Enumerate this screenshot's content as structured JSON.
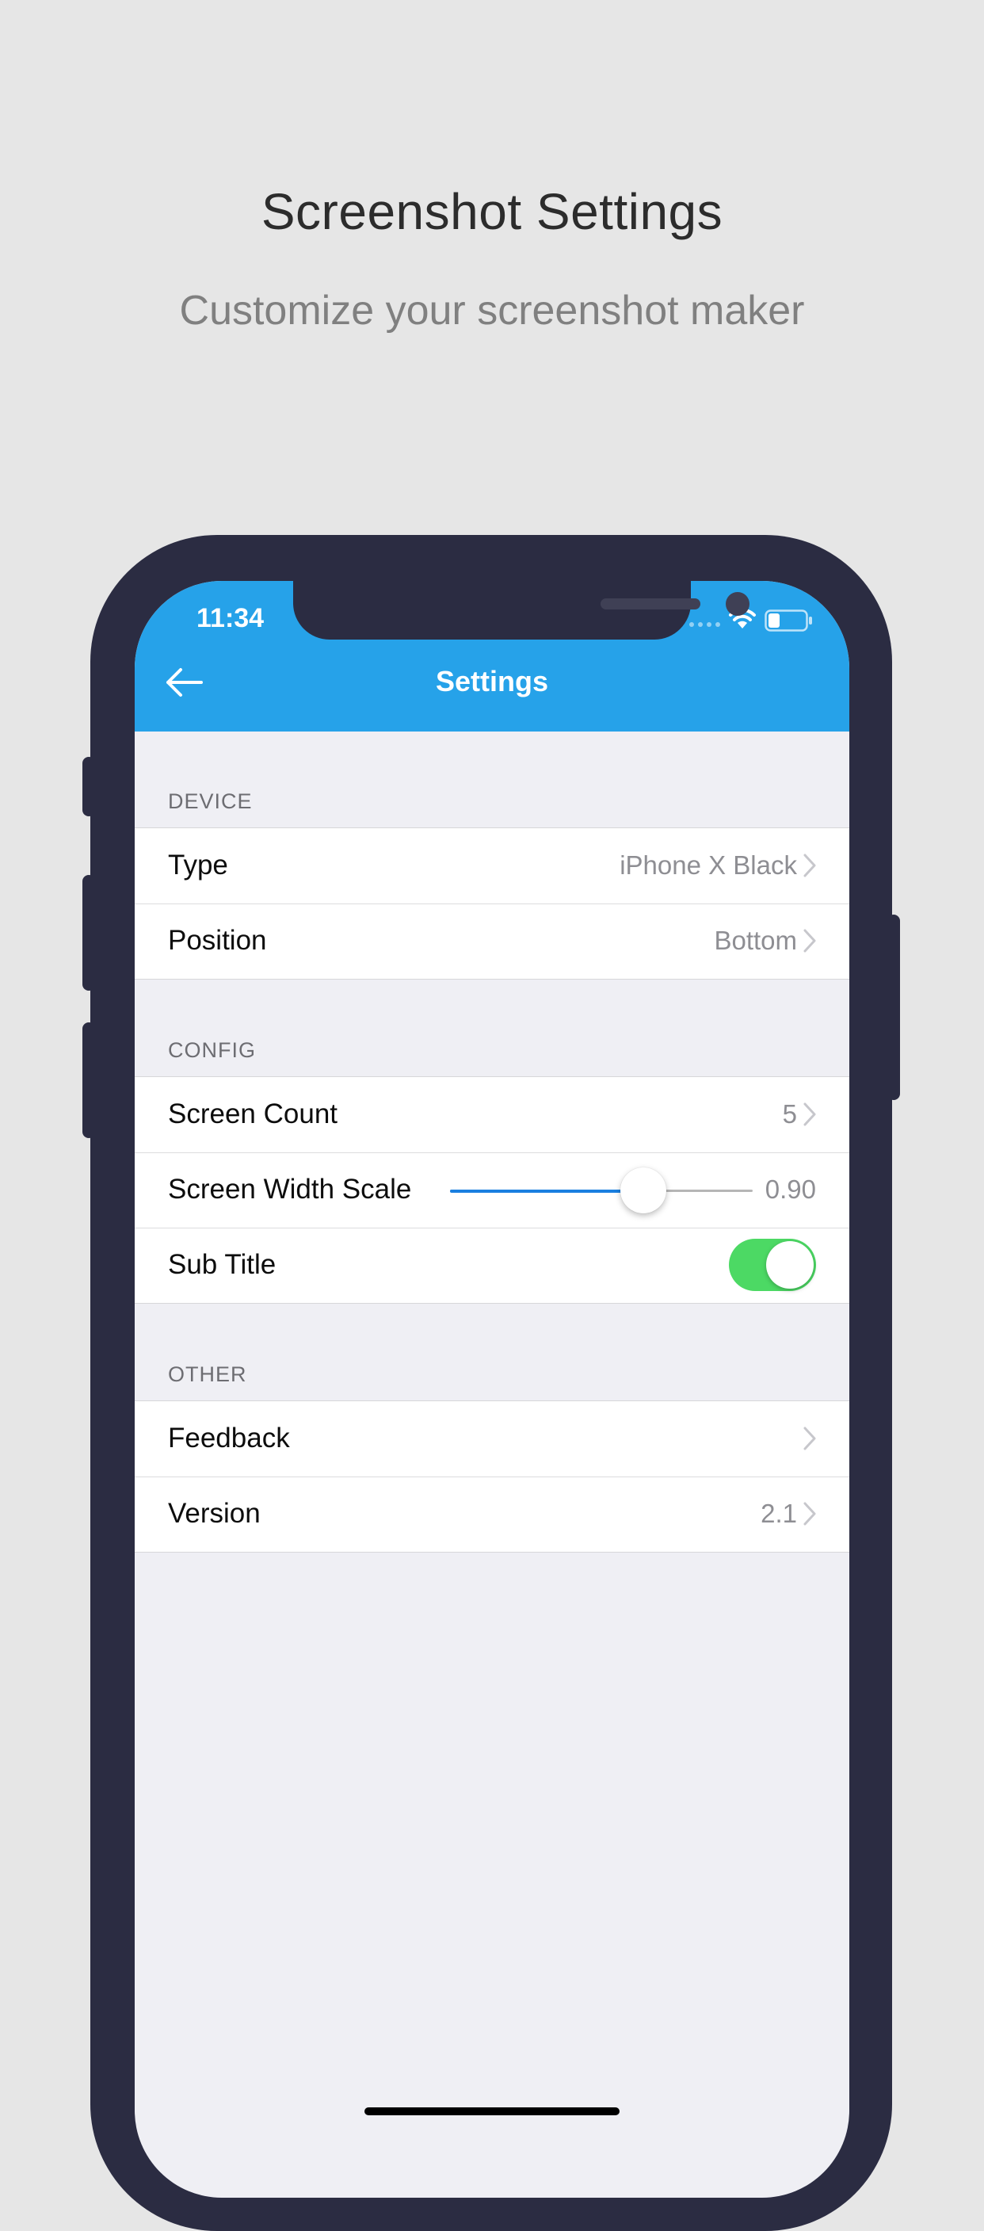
{
  "header": {
    "title": "Screenshot Settings",
    "subtitle": "Customize your screenshot maker"
  },
  "status_bar": {
    "time": "11:34",
    "icons": [
      "signal-dots-icon",
      "wifi-icon",
      "battery-icon"
    ]
  },
  "navbar": {
    "title": "Settings",
    "back_icon": "arrow-left-icon",
    "color": "#26a2e9"
  },
  "sections": {
    "device": {
      "header": "DEVICE",
      "type_label": "Type",
      "type_value": "iPhone X Black",
      "position_label": "Position",
      "position_value": "Bottom"
    },
    "config": {
      "header": "CONFIG",
      "screen_count_label": "Screen Count",
      "screen_count_value": "5",
      "width_scale_label": "Screen Width Scale",
      "width_scale_value": "0.90",
      "width_scale_fraction": 0.64,
      "subtitle_label": "Sub Title",
      "subtitle_enabled": true
    },
    "other": {
      "header": "OTHER",
      "feedback_label": "Feedback",
      "version_label": "Version",
      "version_value": "2.1"
    }
  },
  "colors": {
    "accent": "#26a2e9",
    "toggle_on": "#4cd964",
    "slider_fill": "#1a7fe0",
    "phone_frame": "#2b2c42"
  }
}
